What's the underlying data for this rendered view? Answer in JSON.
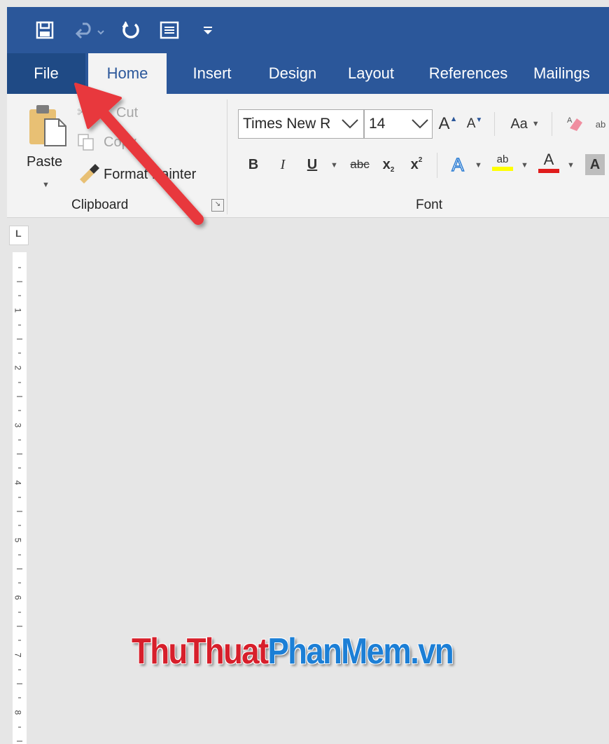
{
  "colors": {
    "title_bar": "#2b579a",
    "file_tab": "#1f4a85",
    "ribbon": "#f3f3f3",
    "arrow": "#e8393d",
    "watermark_red": "#d71f2b",
    "watermark_blue": "#1c7fd6"
  },
  "quick_access": {
    "icons": [
      "save-icon",
      "undo-icon",
      "redo-icon",
      "print-preview-icon",
      "customize-qat-icon"
    ]
  },
  "tabs": [
    {
      "label": "File"
    },
    {
      "label": "Home"
    },
    {
      "label": "Insert"
    },
    {
      "label": "Design"
    },
    {
      "label": "Layout"
    },
    {
      "label": "References"
    },
    {
      "label": "Mailings"
    }
  ],
  "clipboard": {
    "paste_label": "Paste",
    "cut_label": "Cut",
    "copy_label": "Copy",
    "format_painter_label": "Format Painter",
    "group_label": "Clipboard"
  },
  "font": {
    "font_name": "Times New R",
    "font_size": "14",
    "change_case_label": "Aa",
    "bold_label": "B",
    "italic_label": "I",
    "underline_label": "U",
    "strikethrough_label": "abc",
    "subscript_label": "x",
    "superscript_label": "x",
    "text_effects_label": "A",
    "highlight_label": "ab",
    "font_color_label": "A",
    "shading_label": "A",
    "group_label": "Font"
  },
  "ruler": {
    "corner_label": "L",
    "marks": [
      "1",
      "2",
      "3",
      "4",
      "5",
      "6",
      "7",
      "8"
    ]
  },
  "watermark": {
    "part1": "ThuThuat",
    "part2": "PhanMem.vn"
  }
}
